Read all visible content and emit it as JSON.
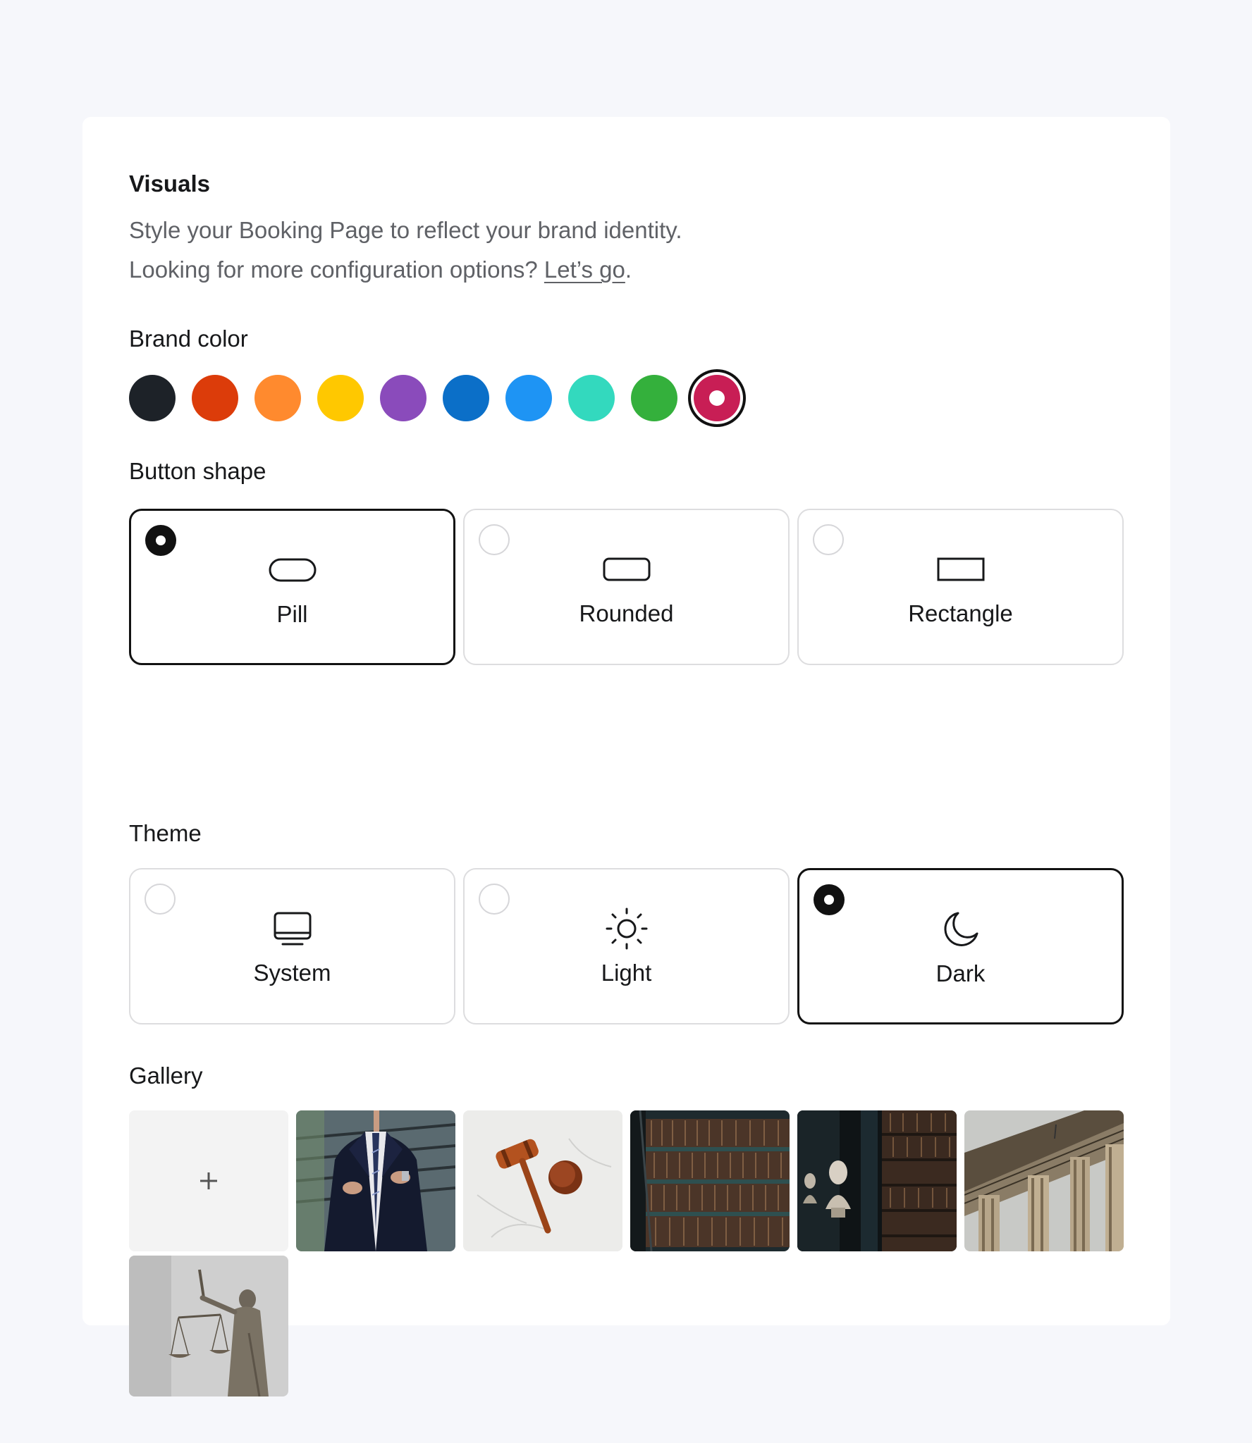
{
  "visuals": {
    "heading": "Visuals",
    "description_line1": "Style your Booking Page to reflect your brand identity.",
    "description_line2_prefix": "Looking for more configuration options? ",
    "description_link": "Let’s go",
    "description_line2_suffix": "."
  },
  "brand_color": {
    "label": "Brand color",
    "colors": [
      "#1d2228",
      "#dc3c0a",
      "#ff8a2e",
      "#ffc800",
      "#8a4bbb",
      "#0b6fc8",
      "#1e94f4",
      "#33d9be",
      "#34b03c",
      "#c81e55"
    ],
    "selected_index": 9
  },
  "button_shape": {
    "label": "Button shape",
    "options": [
      {
        "label": "Pill",
        "icon": "pill-shape-icon",
        "selected": true
      },
      {
        "label": "Rounded",
        "icon": "rounded-shape-icon",
        "selected": false
      },
      {
        "label": "Rectangle",
        "icon": "rectangle-shape-icon",
        "selected": false
      }
    ]
  },
  "theme": {
    "label": "Theme",
    "options": [
      {
        "label": "System",
        "icon": "monitor-icon",
        "selected": false
      },
      {
        "label": "Light",
        "icon": "sun-icon",
        "selected": false
      },
      {
        "label": "Dark",
        "icon": "moon-icon",
        "selected": true
      }
    ]
  },
  "gallery": {
    "label": "Gallery",
    "add_icon": "plus-icon",
    "images": [
      "businessman-in-suit-photo",
      "gavel-on-marble-photo",
      "library-bookshelves-photo",
      "library-busts-photo",
      "courthouse-columns-photo",
      "lady-justice-statue-photo"
    ]
  }
}
